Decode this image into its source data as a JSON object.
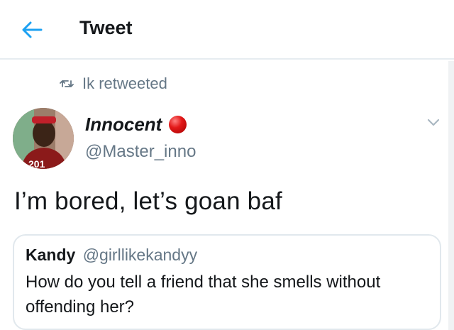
{
  "header": {
    "title": "Tweet",
    "back_icon": "arrow-left-icon"
  },
  "retweet": {
    "icon": "retweet-icon",
    "text": "Ik retweeted"
  },
  "tweet": {
    "author_name": "Innocent",
    "author_handle": "@Master_inno",
    "badge": "red-circle-emoji",
    "text": "I’m bored, let’s goan baf",
    "menu_icon": "chevron-down-icon"
  },
  "quoted_tweet": {
    "author_name": "Kandy",
    "author_handle": "@girllikekandyy",
    "text": "How do you tell a friend that she smells without offending her?"
  },
  "colors": {
    "accent": "#1da1f2",
    "secondary_text": "#657786",
    "primary_text": "#14171a",
    "border": "#e1e8ed"
  }
}
